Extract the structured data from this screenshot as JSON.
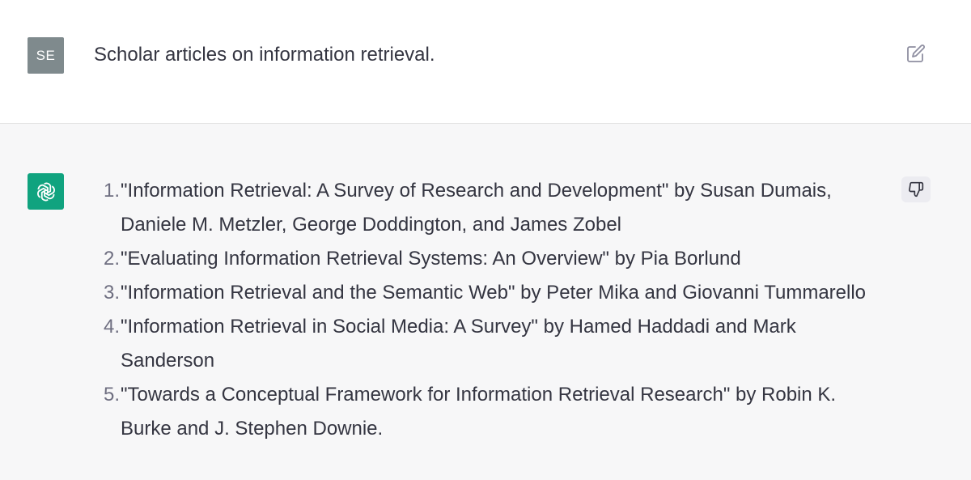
{
  "user": {
    "avatar_initials": "SE",
    "message": "Scholar articles on information retrieval.",
    "edit_icon": "edit-icon"
  },
  "assistant": {
    "avatar_icon": "openai-logo-icon",
    "feedback_icon": "thumbs-down-icon",
    "items": [
      {
        "num": "1.",
        "text": "\"Information Retrieval: A Survey of Research and Development\" by Susan Dumais, Daniele M. Metzler, George Doddington, and James Zobel"
      },
      {
        "num": "2.",
        "text": "\"Evaluating Information Retrieval Systems: An Overview\" by Pia Borlund"
      },
      {
        "num": "3.",
        "text": "\"Information Retrieval and the Semantic Web\" by Peter Mika and Giovanni Tummarello"
      },
      {
        "num": "4.",
        "text": "\"Information Retrieval in Social Media: A Survey\" by Hamed Haddadi and Mark Sanderson"
      },
      {
        "num": "5.",
        "text": "\"Towards a Conceptual Framework for Information Retrieval Research\" by Robin K. Burke and J. Stephen Downie."
      }
    ]
  },
  "colors": {
    "user_avatar_bg": "#7f8a8d",
    "bot_avatar_bg": "#10a37f",
    "assistant_bg": "#f7f7f8",
    "text": "#343541"
  }
}
